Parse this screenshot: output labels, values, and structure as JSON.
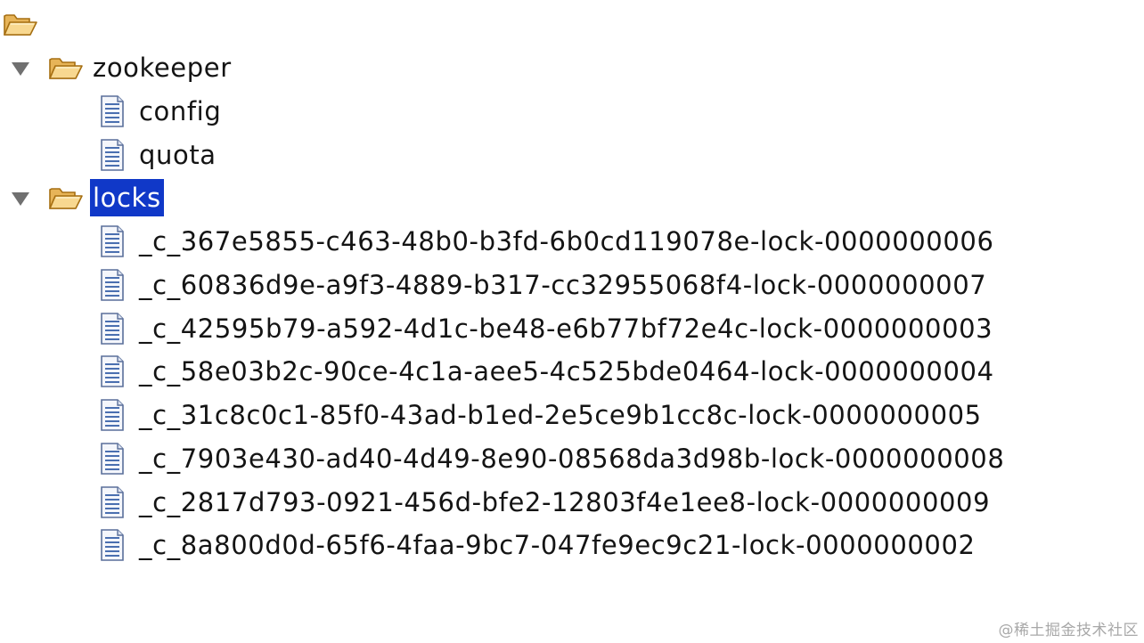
{
  "tree": {
    "root_icon": "folder-open-icon",
    "nodes": {
      "zookeeper": {
        "label": "zookeeper",
        "expanded": true,
        "icon": "folder-open-icon",
        "children": [
          {
            "label": "config",
            "icon": "file-icon"
          },
          {
            "label": "quota",
            "icon": "file-icon"
          }
        ]
      },
      "locks": {
        "label": "locks",
        "expanded": true,
        "selected": true,
        "icon": "folder-open-icon",
        "children": [
          {
            "label": "_c_367e5855-c463-48b0-b3fd-6b0cd119078e-lock-0000000006",
            "icon": "file-icon"
          },
          {
            "label": "_c_60836d9e-a9f3-4889-b317-cc32955068f4-lock-0000000007",
            "icon": "file-icon"
          },
          {
            "label": "_c_42595b79-a592-4d1c-be48-e6b77bf72e4c-lock-0000000003",
            "icon": "file-icon"
          },
          {
            "label": "_c_58e03b2c-90ce-4c1a-aee5-4c525bde0464-lock-0000000004",
            "icon": "file-icon"
          },
          {
            "label": "_c_31c8c0c1-85f0-43ad-b1ed-2e5ce9b1cc8c-lock-0000000005",
            "icon": "file-icon"
          },
          {
            "label": "_c_7903e430-ad40-4d49-8e90-08568da3d98b-lock-0000000008",
            "icon": "file-icon"
          },
          {
            "label": "_c_2817d793-0921-456d-bfe2-12803f4e1ee8-lock-0000000009",
            "icon": "file-icon"
          },
          {
            "label": "_c_8a800d0d-65f6-4faa-9bc7-047fe9ec9c21-lock-0000000002",
            "icon": "file-icon"
          }
        ]
      }
    }
  },
  "colors": {
    "selection_bg": "#1038c8",
    "selection_text": "#ffffff",
    "folder_fill": "#f2c062",
    "folder_stroke": "#b07a1a",
    "file_lines": "#4a6fb0"
  },
  "watermark": "@稀土掘金技术社区"
}
